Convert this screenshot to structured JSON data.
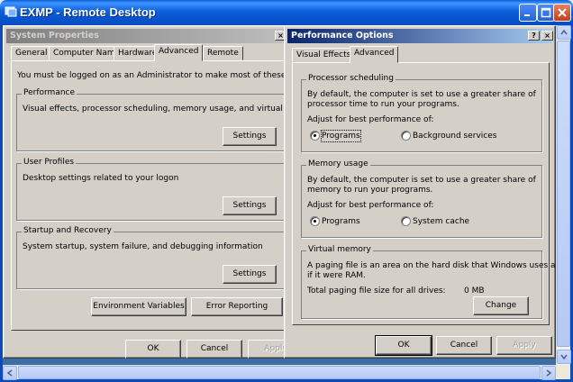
{
  "remote_desktop": {
    "title": "EXMP - Remote Desktop"
  },
  "system_properties": {
    "title": "System Properties",
    "close_glyph": "×",
    "tabs": [
      "General",
      "Computer Name",
      "Hardware",
      "Advanced",
      "Remote"
    ],
    "selected_tab": "Advanced",
    "admin_note": "You must be logged on as an Administrator to make most of these changes",
    "performance": {
      "label": "Performance",
      "description": "Visual effects, processor scheduling, memory usage, and virtual memory",
      "button": "Settings"
    },
    "user_profiles": {
      "label": "User Profiles",
      "description": "Desktop settings related to your logon",
      "button": "Settings"
    },
    "startup_recovery": {
      "label": "Startup and Recovery",
      "description": "System startup, system failure, and debugging information",
      "button": "Settings"
    },
    "env_vars_button": "Environment Variables",
    "error_reporting_button": "Error Reporting",
    "ok_button": "OK",
    "cancel_button": "Cancel",
    "apply_button": "Apply"
  },
  "performance_options": {
    "title": "Performance Options",
    "help_glyph": "?",
    "close_glyph": "×",
    "tabs": [
      "Visual Effects",
      "Advanced"
    ],
    "selected_tab": "Advanced",
    "processor": {
      "label": "Processor scheduling",
      "description_line1": "By default, the computer is set to use a greater share of",
      "description_line2": "processor time to run your programs.",
      "adjust": "Adjust for best performance of:",
      "option_programs": "Programs",
      "option_background": "Background services",
      "selected": "Programs"
    },
    "memory": {
      "label": "Memory usage",
      "description_line1": "By default, the computer is set to use a greater share of",
      "description_line2": "memory to run your programs.",
      "adjust": "Adjust for best performance of:",
      "option_programs": "Programs",
      "option_cache": "System cache",
      "selected": "Programs"
    },
    "virtual_memory": {
      "label": "Virtual memory",
      "description_line1": "A paging file is an area on the hard disk that Windows uses as",
      "description_line2": "if it were RAM.",
      "total_label": "Total paging file size for all drives:",
      "total_value": "0 MB",
      "change_button": "Change"
    },
    "ok_button": "OK",
    "cancel_button": "Cancel",
    "apply_button": "Apply"
  },
  "colors": {
    "xp_title_blue": "#0a5fd8",
    "desktop": "#3a6ea5",
    "dialog_face": "#d4d0c8",
    "active_title": "#0a246a"
  }
}
